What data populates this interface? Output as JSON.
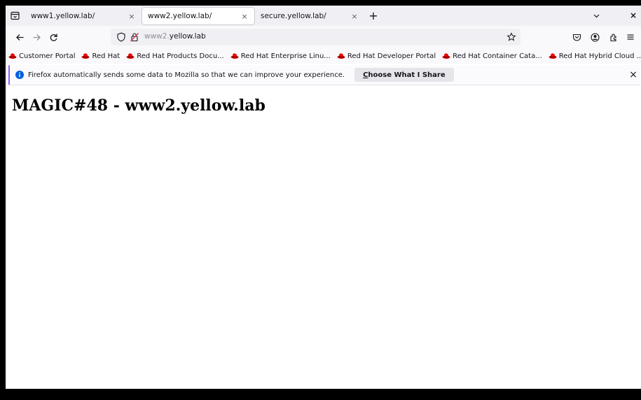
{
  "tabs": [
    {
      "title": "www1.yellow.lab/",
      "close": "×",
      "selected": false
    },
    {
      "title": "www2.yellow.lab/",
      "close": "×",
      "selected": true
    },
    {
      "title": "secure.yellow.lab/",
      "close": "×",
      "selected": false
    }
  ],
  "tabstrip": {
    "new_tab": "+",
    "close_window": "×"
  },
  "urlbar": {
    "host_prefix": "www2.",
    "host": "yellow.lab"
  },
  "bookmarks": [
    "Customer Portal",
    "Red Hat",
    "Red Hat Products Docu...",
    "Red Hat Enterprise Linu...",
    "Red Hat Developer Portal",
    "Red Hat Container Cata...",
    "Red Hat Hybrid Cloud ..."
  ],
  "notification": {
    "message": "Firefox automatically sends some data to Mozilla so that we can improve your experience.",
    "button_mnemonic": "C",
    "button_rest": "hoose What I Share",
    "close": "×"
  },
  "page": {
    "heading": "MAGIC#48 - www2.yellow.lab"
  },
  "colors": {
    "redhat": "#ee0000",
    "info": "#0060df",
    "accent": "#9059ff"
  },
  "icons": [
    "tab-list-icon",
    "back-arrow-icon",
    "forward-arrow-icon",
    "reload-icon",
    "tracking-shield-icon",
    "insecure-lock-icon",
    "bookmark-star-icon",
    "pocket-icon",
    "account-icon",
    "extensions-icon",
    "menu-icon",
    "redhat-fedora-icon",
    "info-icon",
    "chevron-down-icon"
  ]
}
